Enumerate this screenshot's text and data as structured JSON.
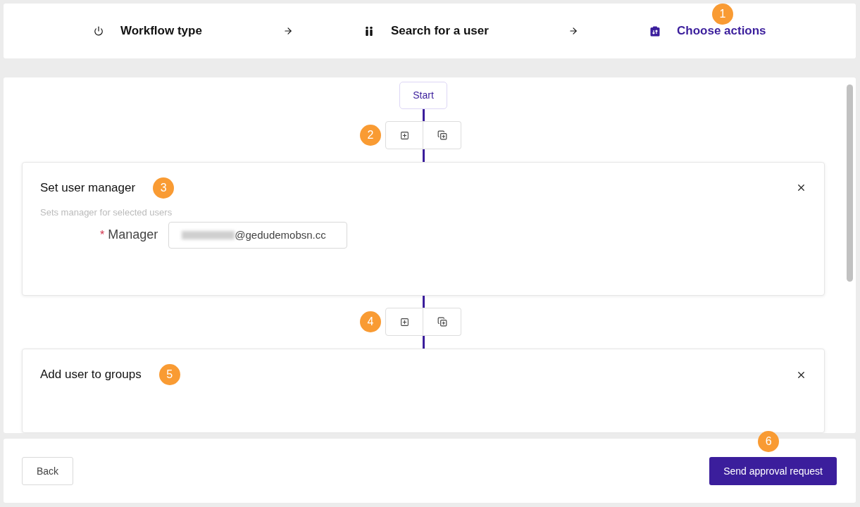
{
  "steps": [
    {
      "kind": "power",
      "label": "Workflow type",
      "selected": false
    },
    {
      "kind": "people",
      "label": "Search for a user",
      "selected": false
    },
    {
      "kind": "clipboard",
      "label": "Choose actions",
      "selected": true,
      "badge": "1"
    }
  ],
  "flow": {
    "start": "Start",
    "items": [
      {
        "kind": "slot",
        "badge": "2"
      },
      {
        "kind": "action",
        "title": "Set user manager",
        "badge": "3",
        "description": "Sets manager for selected users",
        "field": {
          "label": "Manager",
          "required_mark": "*",
          "value": "@gedudemobsn.cc",
          "redacted": true
        }
      },
      {
        "kind": "slot",
        "badge": "4"
      },
      {
        "kind": "action",
        "title": "Add user to groups",
        "badge": "5"
      }
    ]
  },
  "footer": {
    "back": "Back",
    "submit": "Send approval request",
    "submit_badge": "6"
  }
}
